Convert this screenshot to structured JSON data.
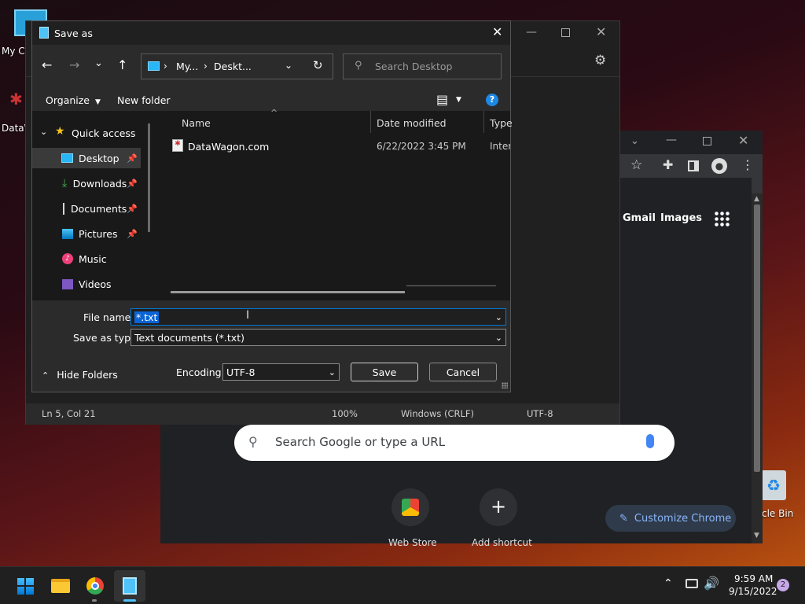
{
  "desktop": {
    "icon_my_computer": "My C",
    "icon_datawagon": "DataW",
    "icon_recycle_bin": "cle Bin"
  },
  "chrome": {
    "links": {
      "gmail": "Gmail",
      "images": "Images"
    },
    "search_placeholder": "Search Google or type a URL",
    "shortcut_web_store": "Web Store",
    "shortcut_add": "Add shortcut",
    "customize": "Customize Chrome"
  },
  "notepad": {
    "status": {
      "position": "Ln 5, Col 21",
      "zoom": "100%",
      "line_ending": "Windows (CRLF)",
      "encoding": "UTF-8"
    }
  },
  "dialog": {
    "title": "Save as",
    "breadcrumb": [
      "My...",
      "Deskt..."
    ],
    "search_placeholder": "Search Desktop",
    "toolbar": {
      "organize": "Organize",
      "new_folder": "New folder"
    },
    "nav": {
      "quick_access": "Quick access",
      "items": [
        {
          "label": "Desktop",
          "pinned": true,
          "selected": true
        },
        {
          "label": "Downloads",
          "pinned": true
        },
        {
          "label": "Documents",
          "pinned": true
        },
        {
          "label": "Pictures",
          "pinned": true
        },
        {
          "label": "Music",
          "pinned": false
        },
        {
          "label": "Videos",
          "pinned": false
        }
      ]
    },
    "columns": {
      "name": "Name",
      "date": "Date modified",
      "type": "Type"
    },
    "files": [
      {
        "name": "DataWagon.com",
        "date": "6/22/2022 3:45 PM",
        "type": "Intern"
      }
    ],
    "file_name_label": "File name:",
    "file_name_value": "*.txt",
    "save_type_label": "Save as type:",
    "save_type_value": "Text documents (*.txt)",
    "hide_folders": "Hide Folders",
    "encoding_label": "Encoding:",
    "encoding_value": "UTF-8",
    "save": "Save",
    "cancel": "Cancel"
  },
  "taskbar": {
    "time": "9:59 AM",
    "date": "9/15/2022",
    "notifications": "2"
  },
  "colors": {
    "accent": "#0078d4",
    "selection": "#0a64d6",
    "chrome_dark": "#202124"
  }
}
